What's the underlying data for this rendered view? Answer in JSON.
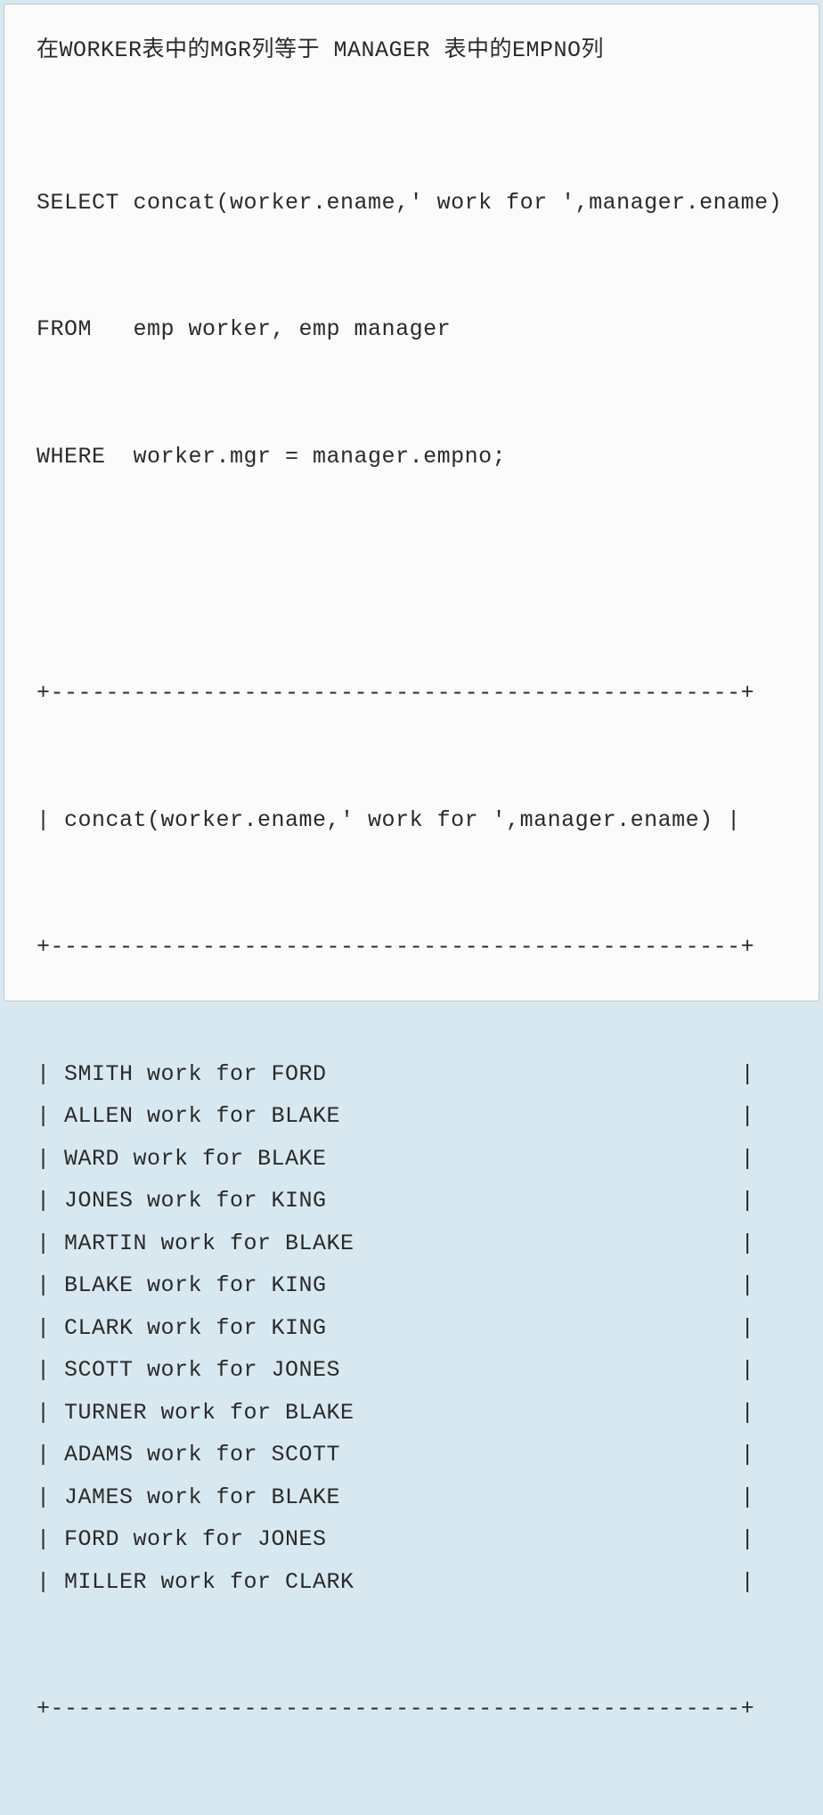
{
  "description": "在WORKER表中的MGR列等于 MANAGER 表中的EMPNO列",
  "sql": {
    "line1": "SELECT concat(worker.ename,' work for ',manager.ename)",
    "line2": "FROM   emp worker, emp manager",
    "line3": "WHERE  worker.mgr = manager.empno;"
  },
  "result": {
    "border_top": "+--------------------------------------------------+",
    "header": "| concat(worker.ename,' work for ',manager.ename) |",
    "border_mid": "+--------------------------------------------------+",
    "rows": [
      "| SMITH work for FORD                              |",
      "| ALLEN work for BLAKE                             |",
      "| WARD work for BLAKE                              |",
      "| JONES work for KING                              |",
      "| MARTIN work for BLAKE                            |",
      "| BLAKE work for KING                              |",
      "| CLARK work for KING                              |",
      "| SCOTT work for JONES                             |",
      "| TURNER work for BLAKE                            |",
      "| ADAMS work for SCOTT                             |",
      "| JAMES work for BLAKE                             |",
      "| FORD work for JONES                              |",
      "| MILLER work for CLARK                            |"
    ],
    "border_bottom": "+--------------------------------------------------+"
  },
  "chart_data": {
    "type": "table",
    "columns": [
      "concat(worker.ename,' work for ',manager.ename)"
    ],
    "rows": [
      [
        "SMITH work for FORD"
      ],
      [
        "ALLEN work for BLAKE"
      ],
      [
        "WARD work for BLAKE"
      ],
      [
        "JONES work for KING"
      ],
      [
        "MARTIN work for BLAKE"
      ],
      [
        "BLAKE work for KING"
      ],
      [
        "CLARK work for KING"
      ],
      [
        "SCOTT work for JONES"
      ],
      [
        "TURNER work for BLAKE"
      ],
      [
        "ADAMS work for SCOTT"
      ],
      [
        "JAMES work for BLAKE"
      ],
      [
        "FORD work for JONES"
      ],
      [
        "MILLER work for CLARK"
      ]
    ]
  }
}
